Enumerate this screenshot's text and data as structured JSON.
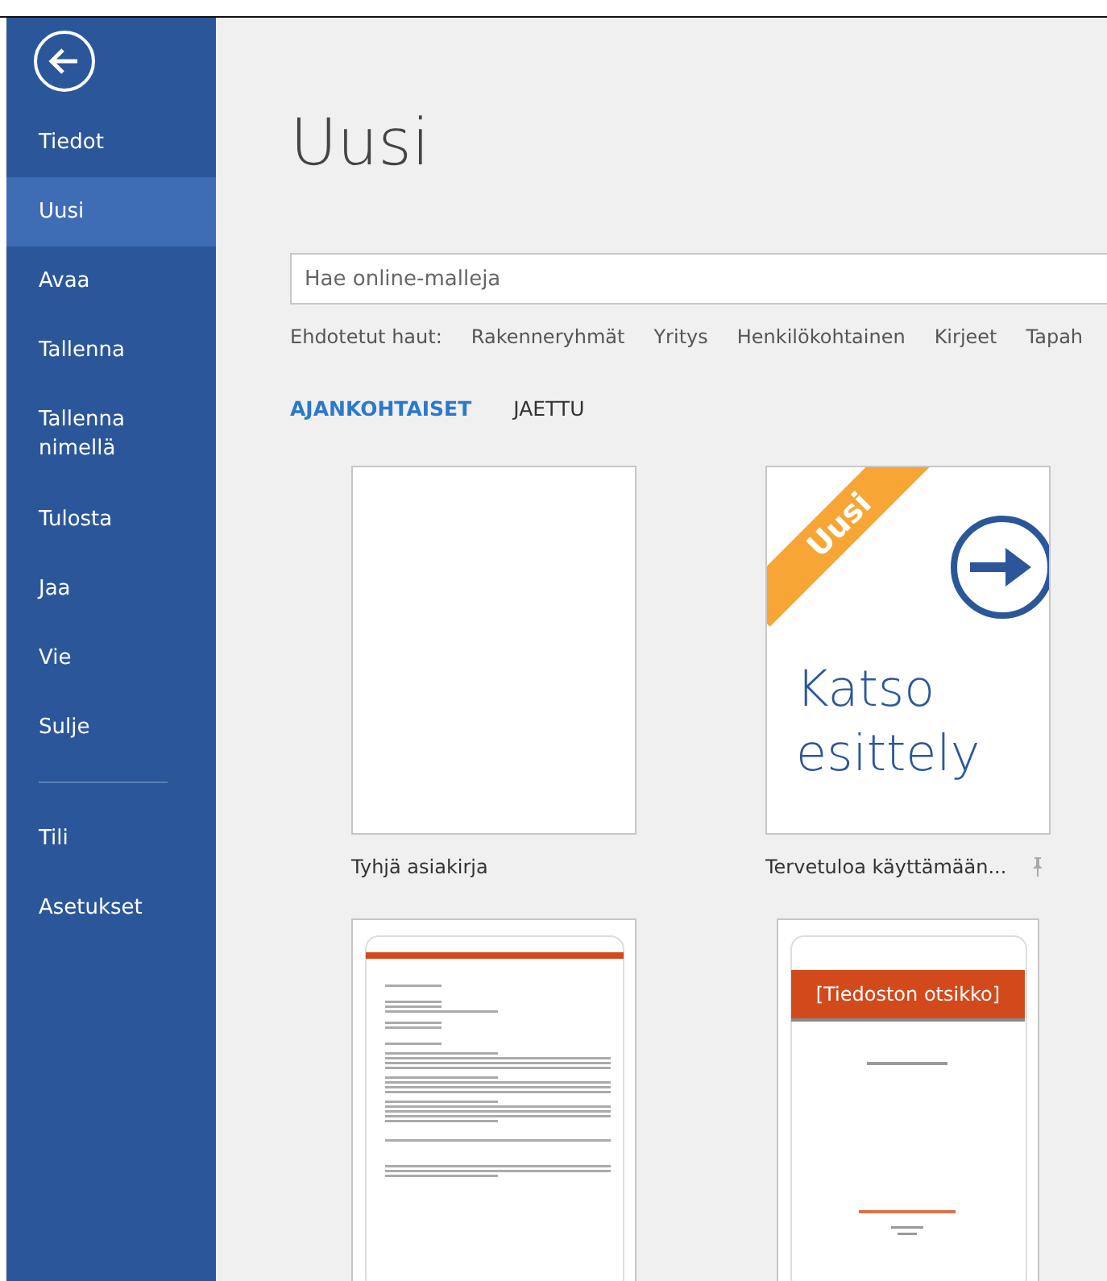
{
  "sidebar": {
    "items": [
      {
        "label": "Tiedot",
        "selected": false
      },
      {
        "label": "Uusi",
        "selected": true
      },
      {
        "label": "Avaa",
        "selected": false
      },
      {
        "label": "Tallenna",
        "selected": false
      },
      {
        "label": "Tallenna nimellä",
        "selected": false
      },
      {
        "label": "Tulosta",
        "selected": false
      },
      {
        "label": "Jaa",
        "selected": false
      },
      {
        "label": "Vie",
        "selected": false
      },
      {
        "label": "Sulje",
        "selected": false
      }
    ],
    "bottom_items": [
      {
        "label": "Tili",
        "selected": false
      },
      {
        "label": "Asetukset",
        "selected": false
      }
    ]
  },
  "page_title": "Uusi",
  "search": {
    "placeholder": "Hae online-malleja"
  },
  "suggested": {
    "label": "Ehdotetut haut:",
    "items": [
      "Rakenneryhmät",
      "Yritys",
      "Henkilökohtainen",
      "Kirjeet",
      "Tapah"
    ]
  },
  "tabs": [
    {
      "label": "AJANKOHTAISET",
      "selected": true
    },
    {
      "label": "JAETTU",
      "selected": false
    }
  ],
  "templates": [
    {
      "kind": "blank",
      "name": "Tyhjä asiakirja"
    },
    {
      "kind": "tour",
      "name": "Tervetuloa käyttämään...",
      "badge": "Uusi",
      "headline": "Katso esittely",
      "pinned": true
    },
    {
      "kind": "letter"
    },
    {
      "kind": "report",
      "title": "[Tiedoston otsikko]"
    }
  ]
}
